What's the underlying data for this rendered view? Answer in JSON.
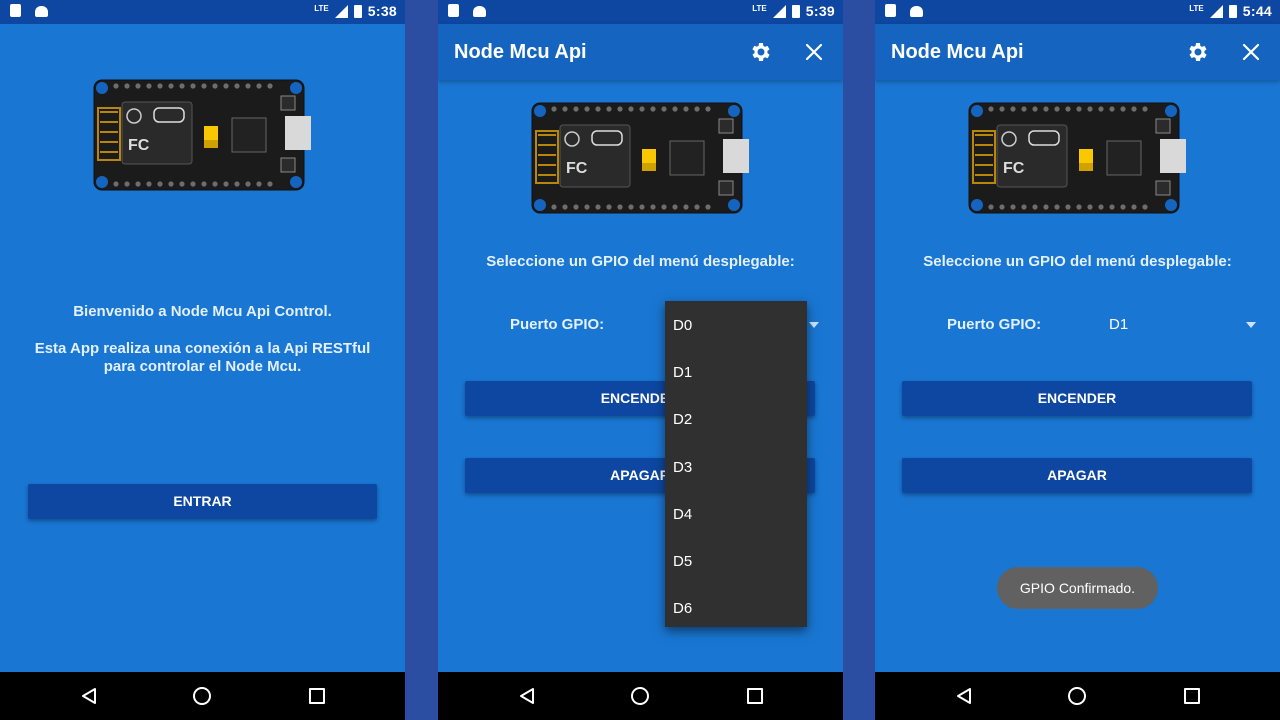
{
  "colors": {
    "background": "#1976d2",
    "statusbar": "#0d47a1",
    "appbar": "#1565c0",
    "button": "#0d47a1",
    "dropdown": "#303030",
    "toast": "#616161"
  },
  "screen1": {
    "status": {
      "time": "5:38",
      "network": "LTE"
    },
    "welcome": "Bienvenido a Node Mcu Api Control.",
    "description_line1": "Esta App realiza una conexión a la Api RESTful",
    "description_line2": "para controlar el Node Mcu.",
    "enter_button": "ENTRAR"
  },
  "screen2": {
    "status": {
      "time": "5:39",
      "network": "LTE"
    },
    "title": "Node Mcu Api",
    "prompt": "Seleccione un GPIO del menú desplegable:",
    "gpio_label": "Puerto GPIO:",
    "on_button": "ENCENDER",
    "off_button": "APAGAR",
    "dropdown_options": [
      "D0",
      "D1",
      "D2",
      "D3",
      "D4",
      "D5",
      "D6"
    ]
  },
  "screen3": {
    "status": {
      "time": "5:44",
      "network": "LTE"
    },
    "title": "Node Mcu Api",
    "prompt": "Seleccione un GPIO del menú desplegable:",
    "gpio_label": "Puerto GPIO:",
    "gpio_selected": "D1",
    "on_button": "ENCENDER",
    "off_button": "APAGAR",
    "toast": "GPIO Confirmado."
  },
  "icons": {
    "statusbar": [
      "sd-card-icon",
      "android-icon",
      "signal-icon",
      "battery-icon"
    ],
    "appbar": [
      "gear-icon",
      "close-icon"
    ],
    "navbar": [
      "back-icon",
      "home-icon",
      "recent-apps-icon"
    ]
  }
}
